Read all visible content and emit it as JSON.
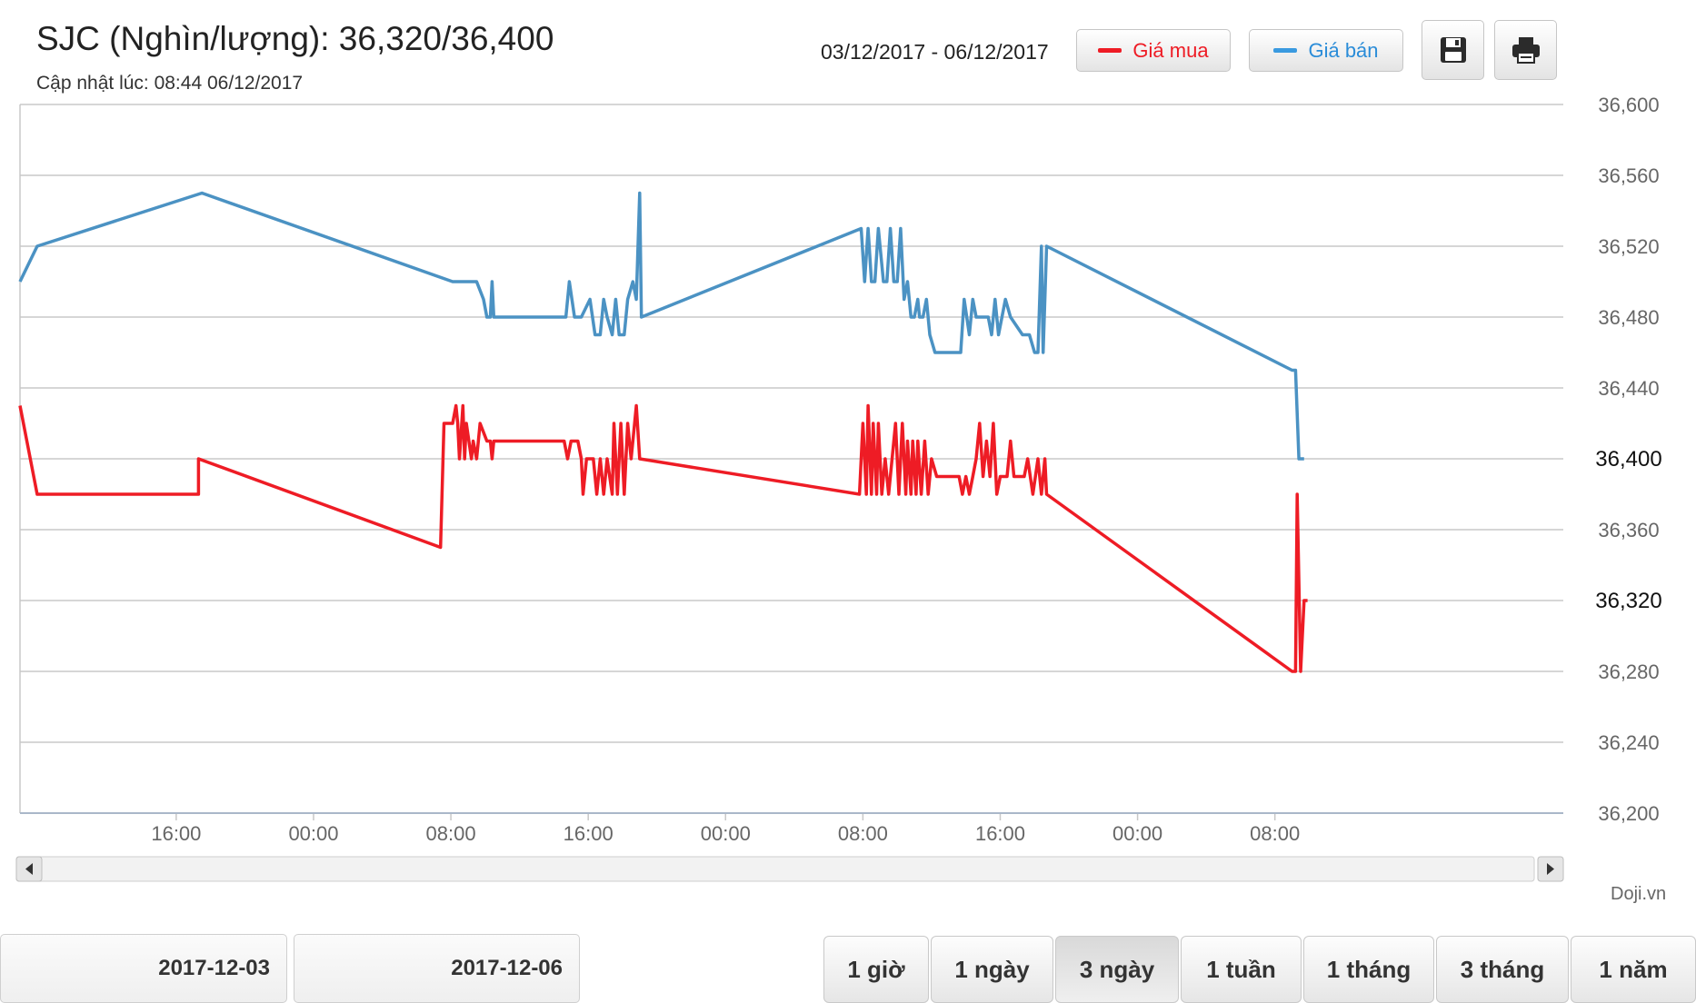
{
  "header": {
    "title": "SJC (Nghìn/lượng): 36,320/36,400",
    "updated": "Cập nhật lúc: 08:44 06/12/2017",
    "date_range": "03/12/2017 - 06/12/2017"
  },
  "toolbar": {
    "buy_label": "Giá mua",
    "sell_label": "Giá bán",
    "save_icon": "floppy-disk-icon",
    "print_icon": "printer-icon"
  },
  "colors": {
    "buy": "#ee1c25",
    "sell": "#4b92c3",
    "grid": "#c8c8c8"
  },
  "footer": {
    "from_date": "2017-12-03",
    "to_date": "2017-12-06",
    "credit": "Doji.vn",
    "zoom_buttons": [
      "1 giờ",
      "1 ngày",
      "3 ngày",
      "1 tuần",
      "1 tháng",
      "3 tháng",
      "1 năm"
    ],
    "active_zoom": "3 ngày"
  },
  "chart_data": {
    "type": "line",
    "x_unit": "hours",
    "x_range": [
      -9.1,
      80.8
    ],
    "x_ticks": [
      {
        "x": 0,
        "label": "16:00"
      },
      {
        "x": 8,
        "label": "00:00"
      },
      {
        "x": 16,
        "label": "08:00"
      },
      {
        "x": 24,
        "label": "16:00"
      },
      {
        "x": 32,
        "label": "00:00"
      },
      {
        "x": 40,
        "label": "08:00"
      },
      {
        "x": 48,
        "label": "16:00"
      },
      {
        "x": 56,
        "label": "00:00"
      },
      {
        "x": 64,
        "label": "08:00"
      }
    ],
    "ylim": [
      36200,
      36600
    ],
    "y_ticks": [
      36200,
      36240,
      36280,
      36320,
      36360,
      36400,
      36440,
      36480,
      36520,
      36560,
      36600
    ],
    "y_highlight": [
      36320,
      36400
    ],
    "grid": true,
    "series": [
      {
        "name": "Giá bán",
        "color": "#4b92c3",
        "points": [
          [
            -9.1,
            36500
          ],
          [
            -8.1,
            36520
          ],
          [
            1.5,
            36550
          ],
          [
            16.1,
            36500
          ],
          [
            17.5,
            36500
          ],
          [
            17.9,
            36490
          ],
          [
            18.1,
            36480
          ],
          [
            18.3,
            36480
          ],
          [
            18.4,
            36500
          ],
          [
            18.5,
            36480
          ],
          [
            21.5,
            36480
          ],
          [
            22.7,
            36480
          ],
          [
            22.9,
            36500
          ],
          [
            23.2,
            36480
          ],
          [
            23.6,
            36480
          ],
          [
            24.1,
            36490
          ],
          [
            24.4,
            36470
          ],
          [
            24.7,
            36470
          ],
          [
            24.9,
            36490
          ],
          [
            25.1,
            36480
          ],
          [
            25.4,
            36470
          ],
          [
            25.6,
            36490
          ],
          [
            25.8,
            36470
          ],
          [
            26.1,
            36470
          ],
          [
            26.3,
            36490
          ],
          [
            26.6,
            36500
          ],
          [
            26.8,
            36490
          ],
          [
            27.0,
            36550
          ],
          [
            27.1,
            36480
          ],
          [
            39.9,
            36530
          ],
          [
            40.1,
            36500
          ],
          [
            40.3,
            36530
          ],
          [
            40.5,
            36500
          ],
          [
            40.7,
            36500
          ],
          [
            40.9,
            36530
          ],
          [
            41.2,
            36500
          ],
          [
            41.4,
            36500
          ],
          [
            41.6,
            36530
          ],
          [
            41.8,
            36500
          ],
          [
            42.0,
            36500
          ],
          [
            42.2,
            36530
          ],
          [
            42.4,
            36490
          ],
          [
            42.6,
            36500
          ],
          [
            42.8,
            36480
          ],
          [
            43.0,
            36480
          ],
          [
            43.2,
            36490
          ],
          [
            43.3,
            36480
          ],
          [
            43.5,
            36480
          ],
          [
            43.7,
            36490
          ],
          [
            43.9,
            36470
          ],
          [
            44.2,
            36460
          ],
          [
            45.7,
            36460
          ],
          [
            45.9,
            36490
          ],
          [
            46.2,
            36470
          ],
          [
            46.4,
            36490
          ],
          [
            46.6,
            36480
          ],
          [
            47.0,
            36480
          ],
          [
            47.3,
            36480
          ],
          [
            47.5,
            36470
          ],
          [
            47.7,
            36490
          ],
          [
            47.9,
            36470
          ],
          [
            48.3,
            36490
          ],
          [
            48.6,
            36480
          ],
          [
            49.3,
            36470
          ],
          [
            49.7,
            36470
          ],
          [
            50.0,
            36460
          ],
          [
            50.2,
            36460
          ],
          [
            50.4,
            36520
          ],
          [
            50.5,
            36460
          ],
          [
            50.7,
            36520
          ],
          [
            65.0,
            36450
          ],
          [
            65.2,
            36450
          ],
          [
            65.4,
            36400
          ],
          [
            65.7,
            36400
          ]
        ]
      },
      {
        "name": "Giá mua",
        "color": "#ee1c25",
        "points": [
          [
            -9.1,
            36430
          ],
          [
            -8.1,
            36380
          ],
          [
            1.3,
            36380
          ],
          [
            1.3,
            36400
          ],
          [
            15.4,
            36350
          ],
          [
            15.6,
            36420
          ],
          [
            16.1,
            36420
          ],
          [
            16.3,
            36430
          ],
          [
            16.4,
            36420
          ],
          [
            16.5,
            36400
          ],
          [
            16.7,
            36430
          ],
          [
            16.8,
            36400
          ],
          [
            16.9,
            36420
          ],
          [
            17.2,
            36400
          ],
          [
            17.3,
            36410
          ],
          [
            17.5,
            36400
          ],
          [
            17.7,
            36420
          ],
          [
            18.1,
            36410
          ],
          [
            18.3,
            36410
          ],
          [
            18.4,
            36400
          ],
          [
            18.5,
            36410
          ],
          [
            22.6,
            36410
          ],
          [
            22.8,
            36400
          ],
          [
            23.0,
            36410
          ],
          [
            23.4,
            36410
          ],
          [
            23.6,
            36400
          ],
          [
            23.7,
            36380
          ],
          [
            23.9,
            36400
          ],
          [
            24.3,
            36400
          ],
          [
            24.5,
            36380
          ],
          [
            24.7,
            36400
          ],
          [
            24.9,
            36380
          ],
          [
            25.1,
            36400
          ],
          [
            25.4,
            36380
          ],
          [
            25.5,
            36420
          ],
          [
            25.7,
            36380
          ],
          [
            25.9,
            36420
          ],
          [
            26.1,
            36380
          ],
          [
            26.3,
            36420
          ],
          [
            26.5,
            36400
          ],
          [
            26.8,
            36430
          ],
          [
            27.0,
            36400
          ],
          [
            39.8,
            36380
          ],
          [
            40.0,
            36420
          ],
          [
            40.2,
            36380
          ],
          [
            40.3,
            36430
          ],
          [
            40.5,
            36380
          ],
          [
            40.6,
            36420
          ],
          [
            40.8,
            36380
          ],
          [
            40.9,
            36420
          ],
          [
            41.1,
            36380
          ],
          [
            41.3,
            36400
          ],
          [
            41.5,
            36380
          ],
          [
            41.7,
            36400
          ],
          [
            41.9,
            36420
          ],
          [
            42.1,
            36380
          ],
          [
            42.3,
            36420
          ],
          [
            42.5,
            36380
          ],
          [
            42.6,
            36410
          ],
          [
            42.8,
            36380
          ],
          [
            42.9,
            36410
          ],
          [
            43.1,
            36380
          ],
          [
            43.2,
            36410
          ],
          [
            43.4,
            36380
          ],
          [
            43.6,
            36410
          ],
          [
            43.8,
            36380
          ],
          [
            44.0,
            36400
          ],
          [
            44.3,
            36390
          ],
          [
            45.6,
            36390
          ],
          [
            45.8,
            36380
          ],
          [
            46.0,
            36390
          ],
          [
            46.2,
            36380
          ],
          [
            46.4,
            36390
          ],
          [
            46.6,
            36400
          ],
          [
            46.8,
            36420
          ],
          [
            47.0,
            36390
          ],
          [
            47.2,
            36410
          ],
          [
            47.4,
            36390
          ],
          [
            47.6,
            36420
          ],
          [
            47.8,
            36380
          ],
          [
            48.0,
            36390
          ],
          [
            48.4,
            36390
          ],
          [
            48.6,
            36410
          ],
          [
            48.8,
            36390
          ],
          [
            49.1,
            36390
          ],
          [
            49.4,
            36390
          ],
          [
            49.6,
            36400
          ],
          [
            49.9,
            36380
          ],
          [
            50.2,
            36400
          ],
          [
            50.4,
            36380
          ],
          [
            50.6,
            36400
          ],
          [
            50.7,
            36380
          ],
          [
            65.0,
            36280
          ],
          [
            65.2,
            36280
          ],
          [
            65.3,
            36380
          ],
          [
            65.5,
            36280
          ],
          [
            65.7,
            36320
          ],
          [
            65.9,
            36320
          ]
        ]
      }
    ]
  }
}
